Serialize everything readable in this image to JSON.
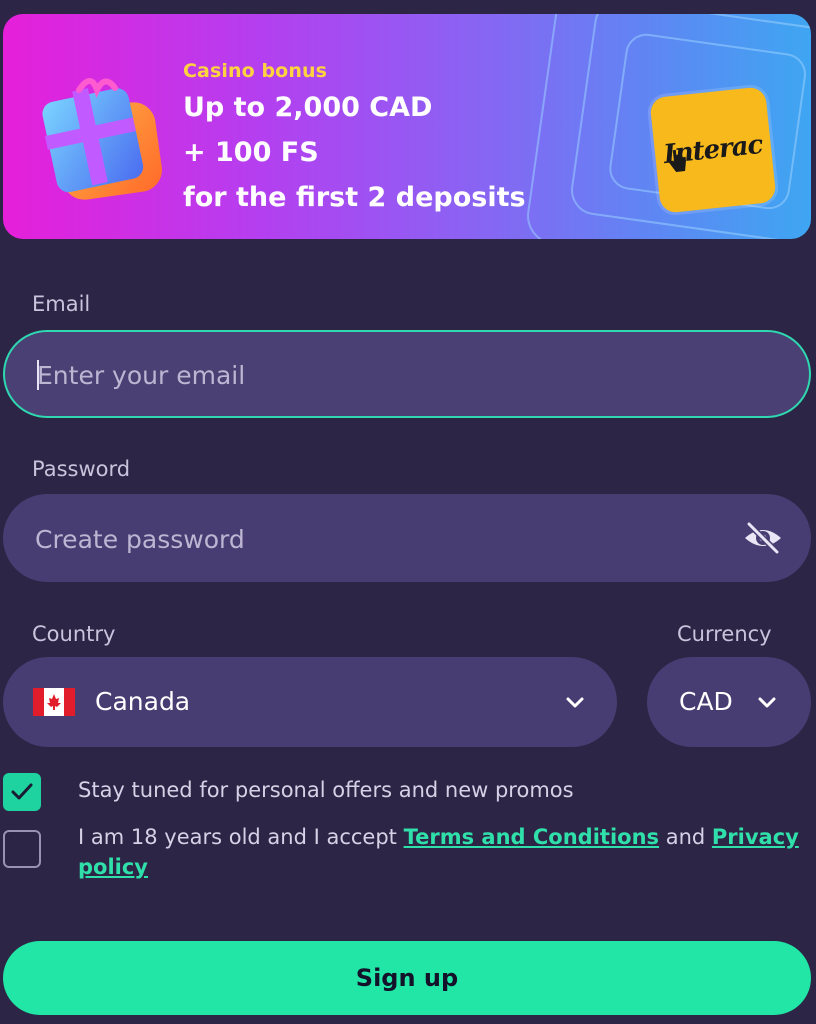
{
  "banner": {
    "tag": "Casino bonus",
    "line1": "Up to 2,000 CAD",
    "line2": "+ 100 FS",
    "line3": "for the first 2 deposits",
    "payment_logo_text": "Interac",
    "colors": {
      "tag": "#ffd23f",
      "logo_bg": "#f7b91c"
    }
  },
  "form": {
    "email": {
      "label": "Email",
      "placeholder": "Enter your email",
      "value": ""
    },
    "password": {
      "label": "Password",
      "placeholder": "Create password",
      "value": "",
      "toggle_icon": "eye-off-icon"
    },
    "country": {
      "label": "Country",
      "value": "Canada",
      "flag_icon": "canada-flag-icon"
    },
    "currency": {
      "label": "Currency",
      "value": "CAD"
    },
    "promos_checkbox": {
      "label": "Stay tuned for personal offers and new promos",
      "checked": true
    },
    "terms_checkbox": {
      "text_before": "I am 18 years old and I accept ",
      "terms_link": "Terms and Conditions",
      "text_middle": " and ",
      "privacy_link": "Privacy policy",
      "checked": false
    },
    "submit_label": "Sign up"
  },
  "colors": {
    "background": "#2c2546",
    "field": "#473d72",
    "accent": "#21e6a6",
    "focus_border": "#2ed8b0"
  }
}
